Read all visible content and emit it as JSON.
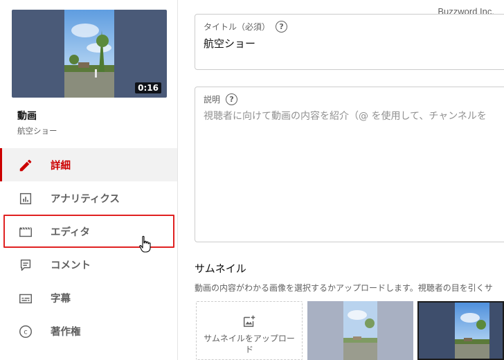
{
  "video": {
    "duration": "0:16",
    "section_title": "動画",
    "video_title": "航空ショー"
  },
  "sidebar": {
    "items": [
      {
        "label": "詳細",
        "icon": "pencil-icon",
        "active": true
      },
      {
        "label": "アナリティクス",
        "icon": "analytics-icon",
        "active": false
      },
      {
        "label": "エディタ",
        "icon": "editor-clapper-icon",
        "active": false
      },
      {
        "label": "コメント",
        "icon": "comment-icon",
        "active": false
      },
      {
        "label": "字幕",
        "icon": "subtitles-icon",
        "active": false
      },
      {
        "label": "著作権",
        "icon": "copyright-icon",
        "active": false
      }
    ]
  },
  "watermark": "Buzzword Inc.",
  "form": {
    "title_label": "タイトル（必須）",
    "title_value": "航空ショー",
    "description_label": "説明",
    "description_placeholder": "視聴者に向けて動画の内容を紹介（@ を使用して、チャンネルを"
  },
  "thumbnail": {
    "heading": "サムネイル",
    "description": "動画の内容がわかる画像を選択するかアップロードします。視聴者の目を引くサ",
    "upload_label": "サムネイルをアップロード"
  },
  "colors": {
    "accent_red": "#cc0000",
    "highlight_box": "#e02020"
  }
}
